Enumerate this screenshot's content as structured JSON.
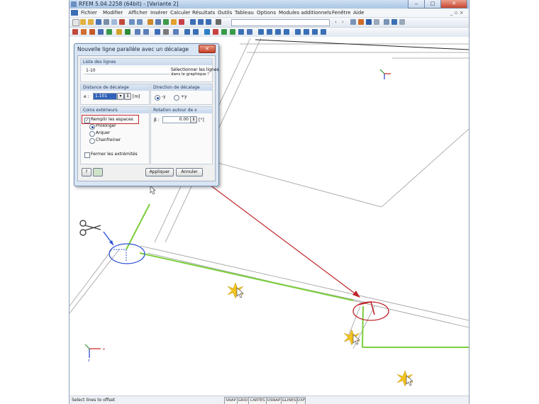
{
  "window": {
    "title": "RFEM 5.04.2258 (64bit) - [Variante 2]",
    "minimize": "‒",
    "maximize": "□",
    "close": "✕"
  },
  "menu": [
    "Fichier",
    "Modifier",
    "Afficher",
    "Insérer",
    "Calculer",
    "Résultats",
    "Outils",
    "Tableau",
    "Options",
    "Modules additionnels",
    "Fenêtre",
    "Aide"
  ],
  "doc_controls": "_ ▫ ×",
  "dialog": {
    "title": "Nouvelle ligne parallèle avec un décalage",
    "close": "✕",
    "lines_group": {
      "header": "Liste des lignes",
      "value": "1-10",
      "select_hint_line1": "Sélectionner les lignes",
      "select_hint_line2": "dans le graphique !"
    },
    "offset_group": {
      "header": "Distance de décalage",
      "e_label": "e :",
      "value": "1.101",
      "unit": "[m]"
    },
    "direction_group": {
      "header": "Direction de décalage",
      "option_neg": "-y",
      "option_pos": "+y",
      "selected": "-y"
    },
    "corners_group": {
      "header": "Coins extérieurs",
      "fill_gaps": "Remplir les espaces",
      "fill_gaps_checked": true,
      "opt_extend": "Prolonger",
      "opt_round": "Arquer",
      "opt_chamfer": "Chanfreiner",
      "selected": "Prolonger",
      "close_ends": "Fermer les extrémités",
      "close_ends_checked": false
    },
    "rotation_group": {
      "header": "Rotation autour de x",
      "beta_label": "β :",
      "value": "0.00",
      "unit": "[°]"
    },
    "apply_button": "Appliquer",
    "cancel_button": "Annuler"
  },
  "status": {
    "text": "Select lines to offset",
    "toggles": [
      "SNAP",
      "GRID",
      "CARTES",
      "OSNAP",
      "GLINES",
      "DXF"
    ]
  },
  "colors": {
    "green_line": "#7ccf3c",
    "gray_line": "#9a9a9a",
    "highlight_red": "#c0262b",
    "ellipse_blue": "#2b4fd6",
    "axis_blue": "#1f3fd0"
  }
}
